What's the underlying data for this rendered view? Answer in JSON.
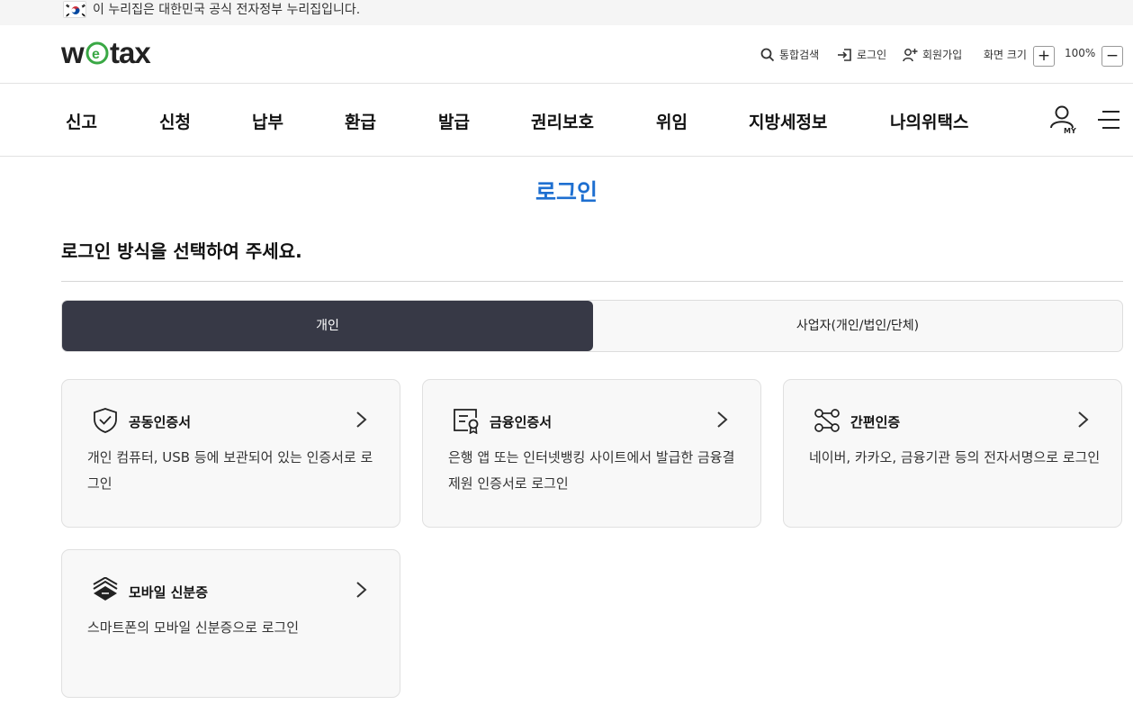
{
  "gov_banner": {
    "text": "이 누리집은 대한민국 공식 전자정부 누리집입니다."
  },
  "header": {
    "logo_text": "wetax",
    "utils": {
      "search": "통합검색",
      "login": "로그인",
      "signup": "회원가입",
      "screen_size": "화면 크기",
      "zoom_in": "+",
      "zoom_level": "100%",
      "zoom_out": "−"
    }
  },
  "nav": {
    "items": [
      "신고",
      "신청",
      "납부",
      "환급",
      "발급",
      "권리보호",
      "위임",
      "지방세정보",
      "나의위택스"
    ],
    "my_label": "MY"
  },
  "main": {
    "title": "로그인",
    "subtitle": "로그인 방식을 선택하여 주세요.",
    "tabs": [
      {
        "label": "개인",
        "active": true
      },
      {
        "label": "사업자(개인/법인/단체)",
        "active": false
      }
    ],
    "cards": [
      {
        "title": "공동인증서",
        "desc": "개인 컴퓨터, USB 등에 보관되어 있는 인증서로 로그인",
        "icon": "shield-check-icon"
      },
      {
        "title": "금융인증서",
        "desc": "은행 앱 또는 인터넷뱅킹 사이트에서 발급한 금융결제원 인증서로 로그인",
        "icon": "certificate-icon"
      },
      {
        "title": "간편인증",
        "desc": "네이버, 카카오, 금융기관 등의 전자서명으로 로그인",
        "icon": "network-nodes-icon"
      },
      {
        "title": "모바일 신분증",
        "desc": "스마트폰의 모바일 신분증으로 로그인",
        "icon": "id-cards-icon"
      }
    ]
  },
  "colors": {
    "accent": "#1e6fd0",
    "tab_active": "#373946",
    "logo_green": "#3aa845"
  }
}
